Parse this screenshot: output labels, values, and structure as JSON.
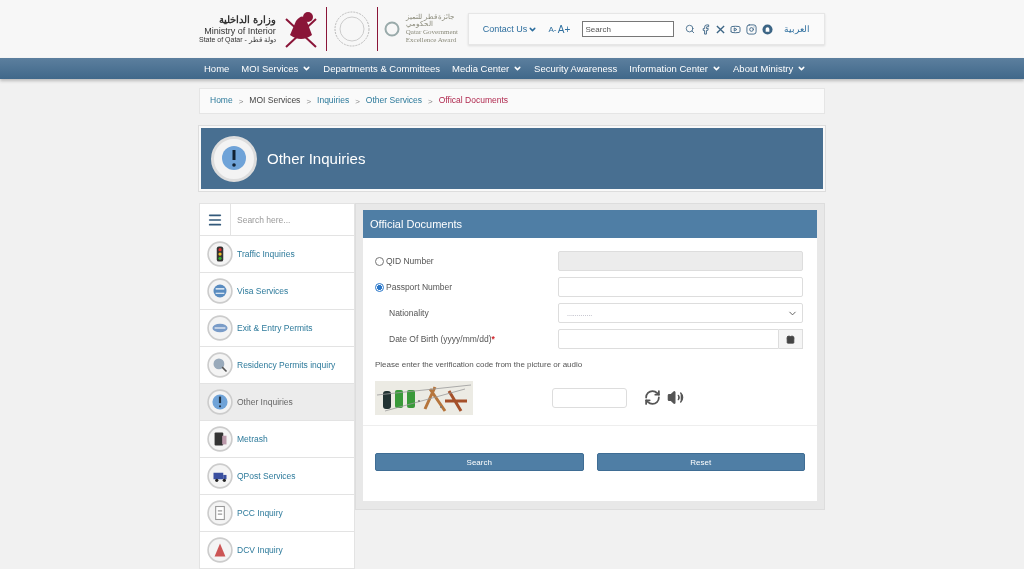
{
  "header": {
    "logo": {
      "arabic_name": "وزارة الداخلية",
      "name": "Ministry of Interior",
      "subtitle": "State of Qatar - دولة قطر"
    },
    "award": {
      "arabic": "جائزة قطر للتميز الحكومي",
      "name": "Qatar Government Excellence Award"
    },
    "contact_label": "Contact Us",
    "font_smaller": "A-",
    "font_larger": "A+",
    "search": {
      "placeholder": "Search"
    },
    "language": "العربية"
  },
  "nav": [
    {
      "label": "Home",
      "dropdown": false
    },
    {
      "label": "MOI Services",
      "dropdown": true
    },
    {
      "label": "Departments & Committees",
      "dropdown": false
    },
    {
      "label": "Media Center",
      "dropdown": true
    },
    {
      "label": "Security Awareness",
      "dropdown": false
    },
    {
      "label": "Information Center",
      "dropdown": true
    },
    {
      "label": "About Ministry",
      "dropdown": true
    }
  ],
  "breadcrumb_separator": ">",
  "breadcrumb": [
    {
      "label": "Home",
      "kind": "link"
    },
    {
      "label": "MOI Services",
      "kind": "text"
    },
    {
      "label": "Inquiries",
      "kind": "link"
    },
    {
      "label": "Other Services",
      "kind": "link"
    },
    {
      "label": "Offical Documents",
      "kind": "current"
    }
  ],
  "banner": {
    "title": "Other Inquiries"
  },
  "sidebar": {
    "search": {
      "placeholder": "Search here..."
    },
    "items": [
      {
        "label": "Traffic Inquiries",
        "selected": false
      },
      {
        "label": "Visa Services",
        "selected": false
      },
      {
        "label": "Exit & Entry Permits",
        "selected": false
      },
      {
        "label": "Residency Permits inquiry",
        "selected": false
      },
      {
        "label": "Other Inquiries",
        "selected": true
      },
      {
        "label": "Metrash",
        "selected": false
      },
      {
        "label": "QPost Services",
        "selected": false
      },
      {
        "label": "PCC Inquiry",
        "selected": false
      },
      {
        "label": "DCV Inquiry",
        "selected": false
      }
    ]
  },
  "form": {
    "title": "Official Documents",
    "id_options": [
      {
        "label": "QID Number",
        "selected": false
      },
      {
        "label": "Passport Number",
        "selected": true
      }
    ],
    "nationality": {
      "label": "Nationality",
      "value": "............."
    },
    "dob": {
      "label": "Date Of Birth (yyyy/mm/dd)",
      "required_mark": "*"
    },
    "captcha": {
      "instruction": "Please enter the verification code from the picture or audio"
    },
    "buttons": [
      "Search",
      "Reset"
    ]
  }
}
